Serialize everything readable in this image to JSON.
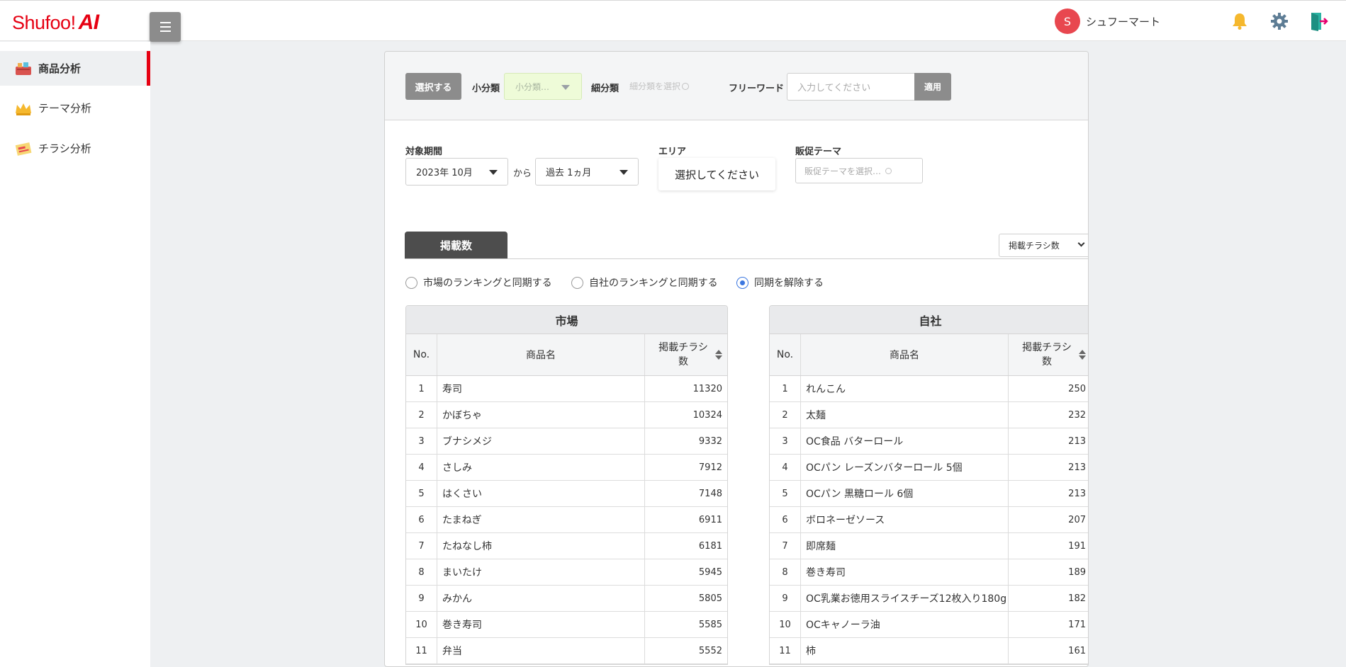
{
  "app": {
    "logo_text": "Shufoo!",
    "logo_ai": "AI"
  },
  "header": {
    "avatar_letter": "S",
    "user_name": "シュフーマート"
  },
  "sidebar": {
    "items": [
      {
        "label": "商品分析",
        "active": true
      },
      {
        "label": "テーマ分析",
        "active": false
      },
      {
        "label": "チラシ分析",
        "active": false
      }
    ]
  },
  "filters": {
    "select_button": "選択する",
    "subcategory_label": "小分類",
    "subcategory_value": "小分類…",
    "fine_label": "細分類",
    "fine_placeholder": "細分類を選択",
    "freeword_label": "フリーワード",
    "freeword_placeholder": "入力してください",
    "apply_button": "適用",
    "period_label": "対象期間",
    "period_start": "2023年 10月",
    "period_from": "から",
    "period_range": "過去 1ヵ月",
    "area_label": "エリア",
    "area_button": "選択してください",
    "theme_label": "販促テーマ",
    "theme_placeholder": "販促テーマを選択…"
  },
  "tabs": {
    "active": "掲載数",
    "metric_select": "掲載チラシ数"
  },
  "sync_options": [
    {
      "label": "市場のランキングと同期する",
      "selected": false
    },
    {
      "label": "自社のランキングと同期する",
      "selected": false
    },
    {
      "label": "同期を解除する",
      "selected": true
    }
  ],
  "market_table": {
    "title": "市場",
    "headers": {
      "no": "No.",
      "name": "商品名",
      "value": "掲載チラシ数"
    },
    "rows": [
      {
        "no": "1",
        "name": "寿司",
        "value": "11320"
      },
      {
        "no": "2",
        "name": "かぼちゃ",
        "value": "10324"
      },
      {
        "no": "3",
        "name": "ブナシメジ",
        "value": "9332"
      },
      {
        "no": "4",
        "name": "さしみ",
        "value": "7912"
      },
      {
        "no": "5",
        "name": "はくさい",
        "value": "7148"
      },
      {
        "no": "6",
        "name": "たまねぎ",
        "value": "6911"
      },
      {
        "no": "7",
        "name": "たねなし柿",
        "value": "6181"
      },
      {
        "no": "8",
        "name": "まいたけ",
        "value": "5945"
      },
      {
        "no": "9",
        "name": "みかん",
        "value": "5805"
      },
      {
        "no": "10",
        "name": "巻き寿司",
        "value": "5585"
      },
      {
        "no": "11",
        "name": "弁当",
        "value": "5552"
      }
    ]
  },
  "own_table": {
    "title": "自社",
    "headers": {
      "no": "No.",
      "name": "商品名",
      "value": "掲載チラシ数"
    },
    "rows": [
      {
        "no": "1",
        "name": "れんこん",
        "value": "250"
      },
      {
        "no": "2",
        "name": "太麺",
        "value": "232"
      },
      {
        "no": "3",
        "name": "OC食品 バターロール",
        "value": "213"
      },
      {
        "no": "4",
        "name": "OCパン レーズンバターロール 5個",
        "value": "213"
      },
      {
        "no": "5",
        "name": "OCパン 黒糖ロール 6個",
        "value": "213"
      },
      {
        "no": "6",
        "name": "ボロネーゼソース",
        "value": "207"
      },
      {
        "no": "7",
        "name": "即席麺",
        "value": "191"
      },
      {
        "no": "8",
        "name": "巻き寿司",
        "value": "189"
      },
      {
        "no": "9",
        "name": "OC乳業お徳用スライスチーズ12枚入り180g",
        "value": "182"
      },
      {
        "no": "10",
        "name": "OCキャノーラ油",
        "value": "171"
      },
      {
        "no": "11",
        "name": "柿",
        "value": "161"
      }
    ]
  }
}
